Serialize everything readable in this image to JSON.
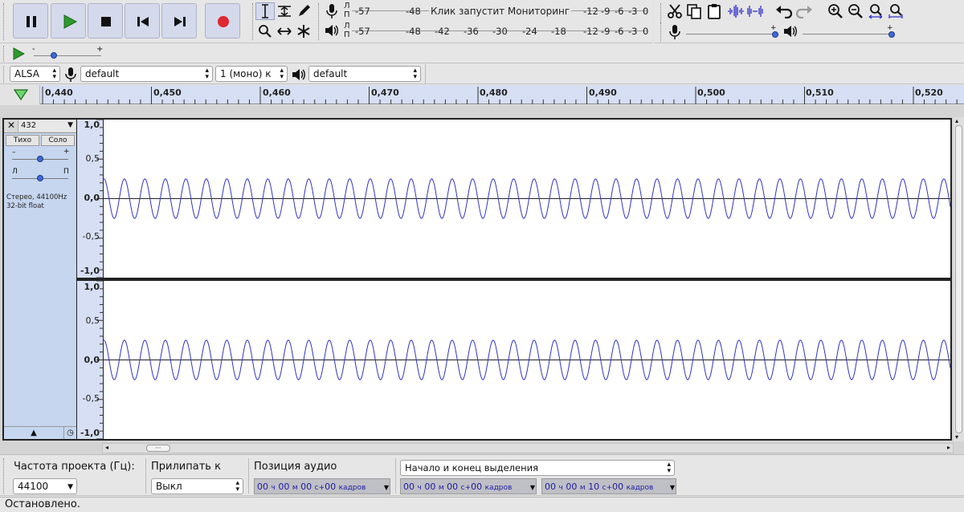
{
  "transport": {
    "pause": "pause-icon",
    "play": "play-icon",
    "stop": "stop-icon",
    "skip_start": "skip-to-start-icon",
    "skip_end": "skip-to-end-icon",
    "record": "record-icon"
  },
  "record_meter": {
    "label_l": "Л",
    "label_r": "П",
    "ticks_left": [
      "-57",
      "-48"
    ],
    "prompt": "Клик запустит Мониторинг",
    "ticks_right": [
      "-12",
      "-9",
      "-6",
      "-3",
      "0"
    ]
  },
  "play_meter": {
    "label_l": "Л",
    "label_r": "П",
    "ticks": [
      "-57",
      "-48",
      "-42",
      "-36",
      "-30",
      "-24",
      "-18",
      "-12",
      "-9",
      "-6",
      "-3",
      "0"
    ]
  },
  "device": {
    "host": "ALSA",
    "rec_device": "default",
    "channels": "1 (моно) к",
    "play_device": "default"
  },
  "ruler": {
    "labels": [
      "0,440",
      "0,450",
      "0,460",
      "0,470",
      "0,480",
      "0,490",
      "0,500",
      "0,510",
      "0,520"
    ]
  },
  "track": {
    "name": "432",
    "mute_label": "Тихо",
    "solo_label": "Соло",
    "gain_minus": "–",
    "gain_plus": "+",
    "pan_left": "Л",
    "pan_right": "П",
    "info_line1": "Стерео, 44100Hz",
    "info_line2": "32-bit float",
    "gain_level": 0.5,
    "pan_level": 0.5
  },
  "scale": {
    "top": [
      "1,0",
      "0,5",
      "0,0",
      "-0,5",
      "-1,0"
    ],
    "bottom": [
      "1,0",
      "0,5",
      "0,0",
      "-0,5",
      "-1,0"
    ]
  },
  "play_at_speed": {
    "minus": "-",
    "plus": "+",
    "speed_level": 0.33
  },
  "selection_bar": {
    "rate_label": "Частота проекта (Гц):",
    "rate_value": "44100",
    "snap_label": "Прилипать к",
    "snap_value": "Выкл",
    "position_label": "Позиция аудио",
    "selection_mode": "Начало и конец выделения",
    "tc_pos": {
      "h": "00",
      "hu": "ч",
      "m": "00",
      "mu": "м",
      "s": "00",
      "su": "с+",
      "f": "00",
      "fu": "кадров"
    },
    "tc_start": {
      "h": "00",
      "hu": "ч",
      "m": "00",
      "mu": "м",
      "s": "00",
      "su": "с+",
      "f": "00",
      "fu": "кадров"
    },
    "tc_end": {
      "h": "00",
      "hu": "ч",
      "m": "00",
      "mu": "м",
      "s": "10",
      "su": "с+",
      "f": "00",
      "fu": "кадров"
    }
  },
  "status": {
    "text": "Остановлено."
  },
  "colors": {
    "accent_button": "#d4d9ec",
    "record_red": "#e0282f",
    "play_green": "#2d9a2d",
    "waveform": "#3232c8",
    "track_panel": "#c6d6ef",
    "ruler": "#d6dff3"
  }
}
